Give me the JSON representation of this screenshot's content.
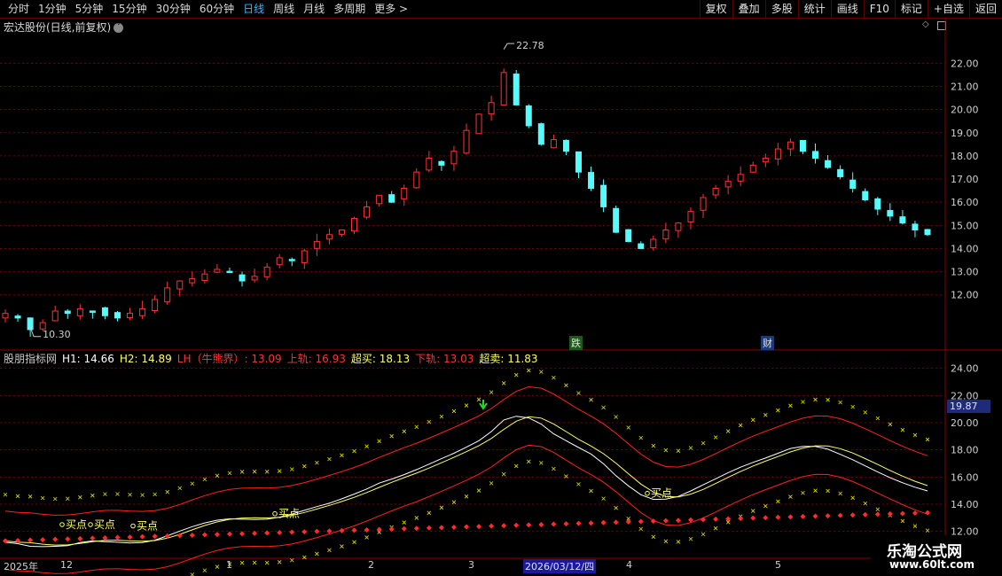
{
  "toolbar": {
    "periods": [
      "分时",
      "1分钟",
      "5分钟",
      "15分钟",
      "30分钟",
      "60分钟",
      "日线",
      "周线",
      "月线",
      "多周期",
      "更多 >"
    ],
    "active_period": "日线",
    "buttons": [
      "复权",
      "叠加",
      "多股",
      "统计",
      "画线",
      "F10",
      "标记",
      "+自选",
      "返回"
    ]
  },
  "stock": {
    "title": "宏达股份(日线,前复权)",
    "high_label": "22.78",
    "low_label": "10.30"
  },
  "badges": {
    "fall": "跌",
    "cai": "财"
  },
  "indicator": {
    "name": "股朋指标网",
    "h1": "H1: 14.66",
    "h2": "H2: 14.89",
    "lh": "LH（牛熊界）: 13.09",
    "upper": "上轨: 16.93",
    "overbuy": "超买: 18.13",
    "lower": "下轨: 13.03",
    "oversell": "超卖: 11.83",
    "current_value": "19.87",
    "buy_label": "买点"
  },
  "colors": {
    "up": "#ff3232",
    "down": "#54fcfc",
    "h1": "#ffffff",
    "h2": "#ffff66",
    "band": "#ff2020",
    "cross": "#e0e000"
  },
  "price_axis": [
    "22.00",
    "21.00",
    "20.00",
    "19.00",
    "18.00",
    "17.00",
    "16.00",
    "15.00",
    "14.00",
    "13.00",
    "12.00"
  ],
  "ind_axis": [
    "24.00",
    "22.00",
    "20.00",
    "18.00",
    "16.00",
    "14.00",
    "12.00"
  ],
  "dates": {
    "year": "2025年",
    "m12": "12",
    "m1": "1",
    "m2": "2",
    "m3": "3",
    "selected": "2026/03/12/四",
    "m4": "4",
    "m5": "5"
  },
  "logo": {
    "line1": "乐淘公式网",
    "line2": "www.60lt.com"
  },
  "chart_data": {
    "type": "candlestick",
    "price_range": [
      10.0,
      23.2
    ],
    "close_path": [
      11.2,
      11.0,
      10.5,
      10.8,
      11.3,
      11.2,
      11.4,
      11.3,
      11.1,
      11.0,
      11.2,
      11.4,
      11.8,
      12.3,
      12.6,
      12.7,
      12.9,
      13.1,
      13.0,
      12.6,
      12.8,
      13.2,
      13.6,
      13.5,
      13.9,
      14.3,
      14.6,
      14.8,
      15.3,
      15.8,
      16.3,
      16.0,
      16.6,
      17.3,
      17.9,
      17.6,
      18.2,
      19.1,
      19.8,
      20.3,
      21.6,
      20.2,
      19.3,
      18.5,
      18.7,
      18.2,
      17.3,
      16.6,
      15.8,
      14.7,
      14.3,
      14.0,
      14.4,
      14.8,
      15.1,
      15.6,
      16.2,
      16.6,
      16.9,
      17.2,
      17.6,
      17.9,
      18.3,
      18.6,
      18.2,
      17.9,
      17.5,
      17.1,
      16.6,
      16.1,
      15.7,
      15.4,
      15.1,
      14.8,
      14.6
    ]
  }
}
